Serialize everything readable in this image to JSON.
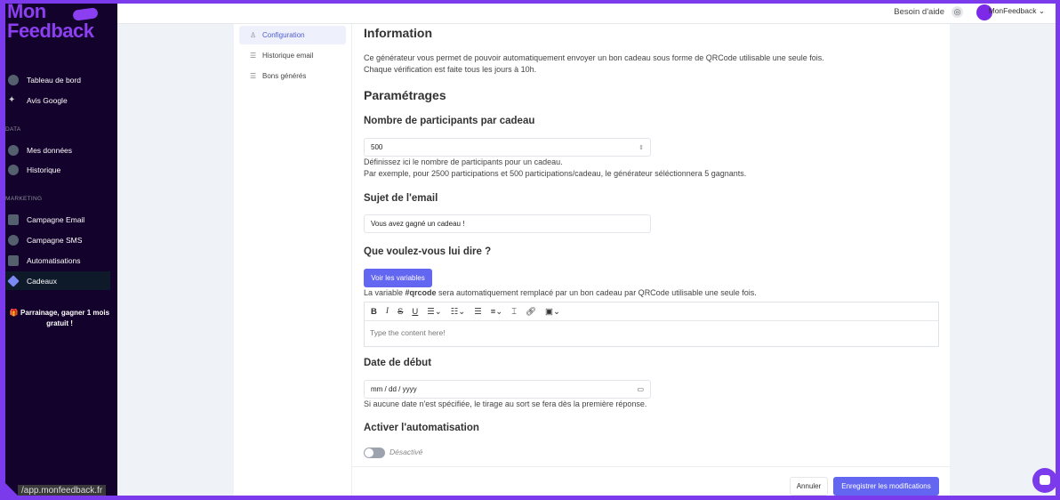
{
  "brand": {
    "line1": "Mon",
    "line2": "Feedback"
  },
  "sidebar": {
    "items": [
      {
        "label": "Tableau de bord"
      },
      {
        "label": "Avis Google"
      },
      {
        "label": "Mes données"
      },
      {
        "label": "Historique"
      },
      {
        "label": "Campagne Email"
      },
      {
        "label": "Campagne SMS"
      },
      {
        "label": "Automatisations"
      },
      {
        "label": "Cadeaux"
      }
    ],
    "sections": {
      "data": "DATA",
      "marketing": "MARKETING"
    },
    "promo": "🎁 Parrainage, gagner 1 mois gratuit !",
    "url": "/app.monfeedback.fr",
    "accent": "#7c3aed"
  },
  "topbar": {
    "help": "Besoin d'aide",
    "user": "MonFeedback"
  },
  "subnav": [
    {
      "label": "Configuration",
      "icon": "user-icon"
    },
    {
      "label": "Historique email",
      "icon": "list-icon"
    },
    {
      "label": "Bons générés",
      "icon": "list-icon"
    }
  ],
  "main": {
    "info_title": "Information",
    "info_p1": "Ce générateur vous permet de pouvoir automatiquement envoyer un bon cadeau sous forme de QRCode utilisable une seule fois.",
    "info_p2": "Chaque vérification est faite tous les jours à 10h.",
    "settings_title": "Paramétrages",
    "participants_label": "Nombre de participants par cadeau",
    "participants_value": "500",
    "participants_help1": "Définissez ici le nombre de participants pour un cadeau.",
    "participants_help2": "Par exemple, pour 2500 participations et 500 participations/cadeau, le générateur séléctionnera 5 gagnants.",
    "subject_label": "Sujet de l'email",
    "subject_value": "Vous avez gagné un cadeau !",
    "message_label": "Que voulez-vous lui dire ?",
    "variables_button": "Voir les variables",
    "variable_pre": "La variable ",
    "variable_code": "#qrcode",
    "variable_post": " sera automatiquement remplacé par un bon cadeau par QRCode utilisable une seule fois.",
    "editor_placeholder": "Type the content here!",
    "date_label": "Date de début",
    "date_placeholder": "mm / dd / yyyy",
    "date_help": "Si aucune date n'est spécifiée, le tirage au sort se fera dès la première réponse.",
    "activate_label": "Activer l'automatisation",
    "toggle_state": "Désactivé",
    "toggle_on": false,
    "cancel": "Annuler",
    "save": "Enregistrer les modifications"
  }
}
